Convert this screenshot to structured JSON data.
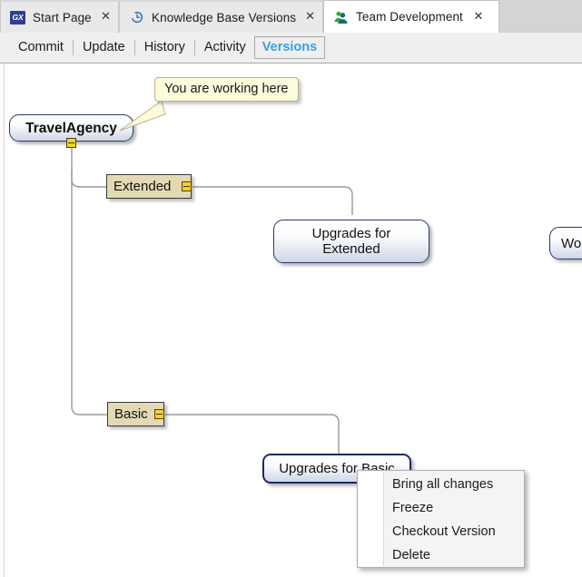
{
  "window": {
    "tabs": [
      {
        "label": "Start Page",
        "icon": "gx-logo-icon",
        "active": false,
        "close_label": "✕"
      },
      {
        "label": "Knowledge Base Versions",
        "icon": "history-revert-icon",
        "active": false,
        "close_label": "✕"
      },
      {
        "label": "Team Development",
        "icon": "team-people-icon",
        "active": true,
        "close_label": "✕"
      }
    ]
  },
  "toolbar": {
    "items": [
      {
        "label": "Commit",
        "selected": false
      },
      {
        "label": "Update",
        "selected": false
      },
      {
        "label": "History",
        "selected": false
      },
      {
        "label": "Activity",
        "selected": false
      },
      {
        "label": "Versions",
        "selected": true
      }
    ],
    "selected_color": "#3c9fe0"
  },
  "diagram": {
    "callout": {
      "text": "You are working here"
    },
    "nodes": [
      {
        "id": "travel-agency",
        "type": "version",
        "label": "TravelAgency",
        "root": true,
        "selected": false
      },
      {
        "id": "extended",
        "type": "branch",
        "label": "Extended"
      },
      {
        "id": "upgrades-for-extended",
        "type": "version",
        "label": "Upgrades for\nExtended",
        "selected": false
      },
      {
        "id": "working-copy-clipped",
        "type": "version",
        "label": "Wo",
        "selected": false
      },
      {
        "id": "basic",
        "type": "branch",
        "label": "Basic"
      },
      {
        "id": "upgrades-for-basic",
        "type": "version",
        "label": "Upgrades for Basic",
        "selected": true
      }
    ]
  },
  "context_menu": {
    "items": [
      {
        "label": "Bring all changes"
      },
      {
        "label": "Freeze"
      },
      {
        "label": "Checkout Version"
      },
      {
        "label": "Delete"
      }
    ]
  }
}
